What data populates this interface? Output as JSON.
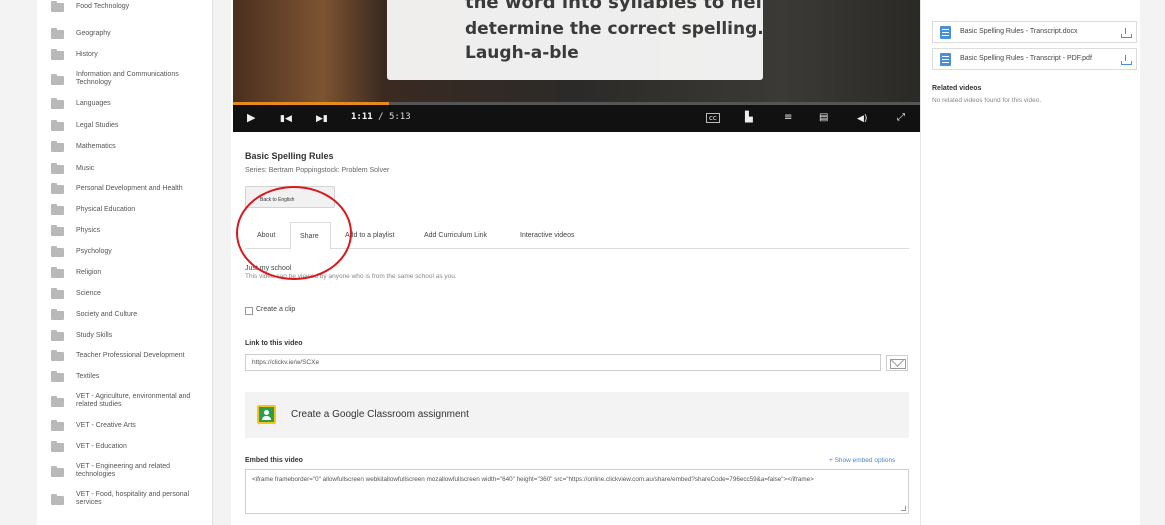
{
  "sidebar": {
    "items": [
      {
        "label": "Food Technology"
      },
      {
        "label": "Geography"
      },
      {
        "label": "History"
      },
      {
        "label": "Information and Communications Technology"
      },
      {
        "label": "Languages"
      },
      {
        "label": "Legal Studies"
      },
      {
        "label": "Mathematics"
      },
      {
        "label": "Music"
      },
      {
        "label": "Personal Development and Health"
      },
      {
        "label": "Physical Education"
      },
      {
        "label": "Physics"
      },
      {
        "label": "Psychology"
      },
      {
        "label": "Religion"
      },
      {
        "label": "Science"
      },
      {
        "label": "Society and Culture"
      },
      {
        "label": "Study Skills"
      },
      {
        "label": "Teacher Professional Development"
      },
      {
        "label": "Textiles"
      },
      {
        "label": "VET - Agriculture, environmental and related studies"
      },
      {
        "label": "VET - Creative Arts"
      },
      {
        "label": "VET - Education"
      },
      {
        "label": "VET - Engineering and related technologies"
      },
      {
        "label": "VET - Food, hospitality and personal services"
      }
    ]
  },
  "video": {
    "subtitle_lines": [
      "the word into syllables to help",
      "determine the correct spelling.",
      "Laugh-a-ble"
    ],
    "time_current": "1:11",
    "time_total": "/ 5:13",
    "progress": 0.227
  },
  "details": {
    "title": "Basic Spelling Rules",
    "series": "Series: Bertram Poppingstock: Problem Solver",
    "back_button": "Back to English"
  },
  "tabs": [
    {
      "label": "About"
    },
    {
      "label": "Share"
    },
    {
      "label": "Add to a playlist"
    },
    {
      "label": "Add Curriculum Link"
    },
    {
      "label": "Interactive videos"
    }
  ],
  "share": {
    "privacy_label": "Just my school",
    "privacy_desc": "This video can be viewed by anyone who is from the same school as you.",
    "create_clip": "Create a clip",
    "link_label": "Link to this video",
    "link_value": "https://clickv.ie/w/SCXe",
    "google_classroom": "Create a Google Classroom assignment",
    "embed_label": "Embed this video",
    "embed_toggle": "+ Show embed options",
    "embed_code": "<iframe frameborder=\"0\" allowfullscreen webkitallowfullscreen mozallowfullscreen width=\"640\" height=\"360\" src=\"https://online.clickview.com.au/share/embed?shareCode=796ecc59&a=false\"></iframe>"
  },
  "right": {
    "files": [
      {
        "name": "Basic Spelling Rules - Transcript.docx"
      },
      {
        "name": "Basic Spelling Rules - Transcript - PDF.pdf"
      }
    ],
    "related_title": "Related videos",
    "related_empty": "No related videos found for this video."
  },
  "colors": {
    "progress": "#e78a1e",
    "annotation": "#d8181c",
    "link": "#4a86c7",
    "doc_icon": "#4a90d9"
  }
}
